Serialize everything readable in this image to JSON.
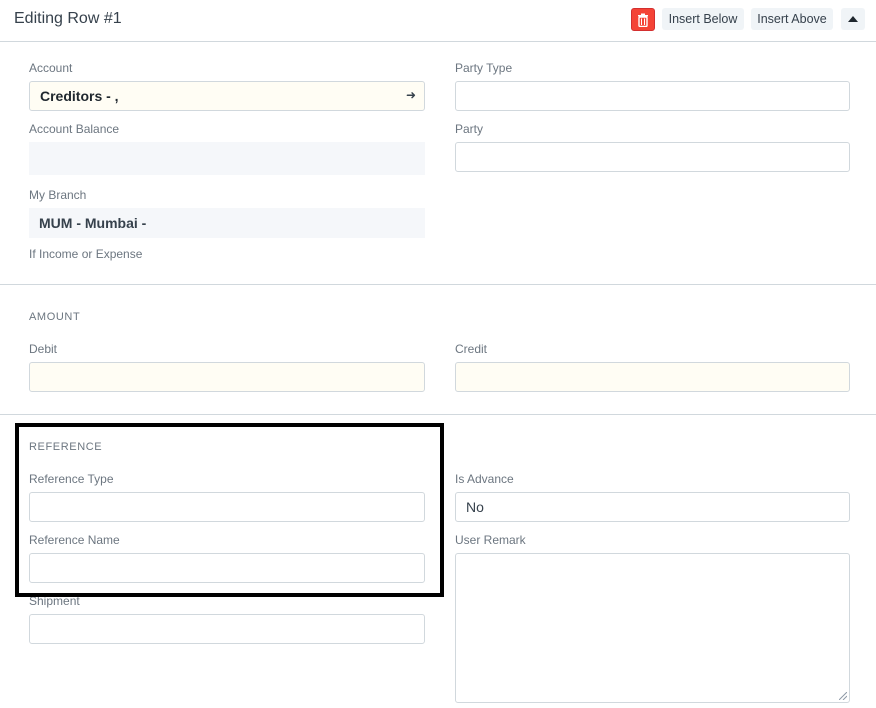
{
  "header": {
    "title": "Editing Row #1",
    "insert_below": "Insert Below",
    "insert_above": "Insert Above"
  },
  "fields": {
    "account_label": "Account",
    "account_value": "Creditors - ,",
    "account_balance_label": "Account Balance",
    "my_branch_label": "My Branch",
    "my_branch_value": "MUM - Mumbai -",
    "income_expense_label": "If Income or Expense",
    "party_type_label": "Party Type",
    "party_label": "Party"
  },
  "amount": {
    "section_title": "AMOUNT",
    "debit_label": "Debit",
    "credit_label": "Credit"
  },
  "reference": {
    "section_title": "REFERENCE",
    "reference_type_label": "Reference Type",
    "reference_name_label": "Reference Name",
    "shipment_label": "Shipment",
    "is_advance_label": "Is Advance",
    "is_advance_value": "No",
    "user_remark_label": "User Remark"
  },
  "colors": {
    "delete_button": "#f44336",
    "highlight_border": "#000000",
    "input_yellow": "#fffdf4"
  }
}
